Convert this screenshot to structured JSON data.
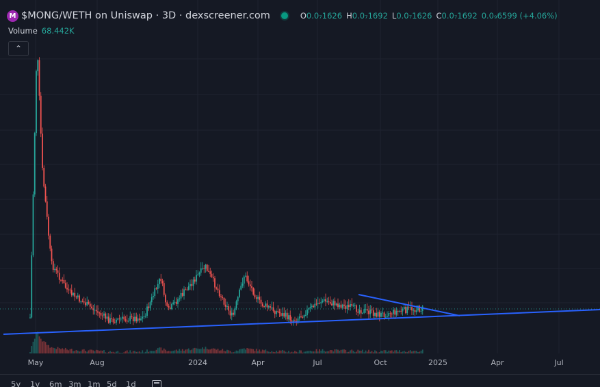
{
  "header": {
    "logo_letter": "M",
    "title": "$MONG/WETH on Uniswap · 3D · dexscreener.com",
    "ohlc": [
      {
        "key": "O",
        "value": "0.0₇1626"
      },
      {
        "key": "H",
        "value": "0.0₇1692"
      },
      {
        "key": "L",
        "value": "0.0₇1626"
      },
      {
        "key": "C",
        "value": "0.0₇1692"
      },
      {
        "key": "",
        "value": "0.0₉6599 (+4.06%)"
      }
    ]
  },
  "volume": {
    "label": "Volume",
    "value": "68.442K"
  },
  "colors": {
    "background": "#151924",
    "up": "#26a69a",
    "down": "#ef5350",
    "trendline": "#2962ff",
    "grid": "#1f2330",
    "text": "#d1d4dc"
  },
  "chart_data": {
    "type": "candlestick",
    "timeframe": "3D",
    "x_ticks": [
      "May",
      "Aug",
      "2024",
      "Apr",
      "Jul",
      "Oct",
      "2025",
      "Apr",
      "Jul"
    ],
    "last_close_line": true,
    "trendlines": [
      "ascending support line",
      "descending resistance line"
    ],
    "price_profile": [
      {
        "t": "Apr 2023",
        "p": 0.03
      },
      {
        "t": "May 2023",
        "p": 1.0
      },
      {
        "t": "late May 2023",
        "p": 0.55
      },
      {
        "t": "Jun 2023",
        "p": 0.22
      },
      {
        "t": "Jul 2023",
        "p": 0.12
      },
      {
        "t": "Sep 2023",
        "p": 0.02
      },
      {
        "t": "Nov 2023",
        "p": 0.03
      },
      {
        "t": "Dec 2023",
        "p": 0.17
      },
      {
        "t": "Jan 2024",
        "p": 0.05
      },
      {
        "t": "Mar 2024",
        "p": 0.21
      },
      {
        "t": "Apr 2024",
        "p": 0.03
      },
      {
        "t": "May 2024",
        "p": 0.18
      },
      {
        "t": "Jun 2024",
        "p": 0.08
      },
      {
        "t": "Aug 2024",
        "p": 0.02
      },
      {
        "t": "Oct 2024",
        "p": 0.09
      },
      {
        "t": "Nov 2024",
        "p": 0.04
      },
      {
        "t": "Nov 2024",
        "p": 0.06
      }
    ]
  },
  "range_buttons": [
    "5y",
    "1y",
    "6m",
    "3m",
    "1m",
    "5d",
    "1d"
  ]
}
